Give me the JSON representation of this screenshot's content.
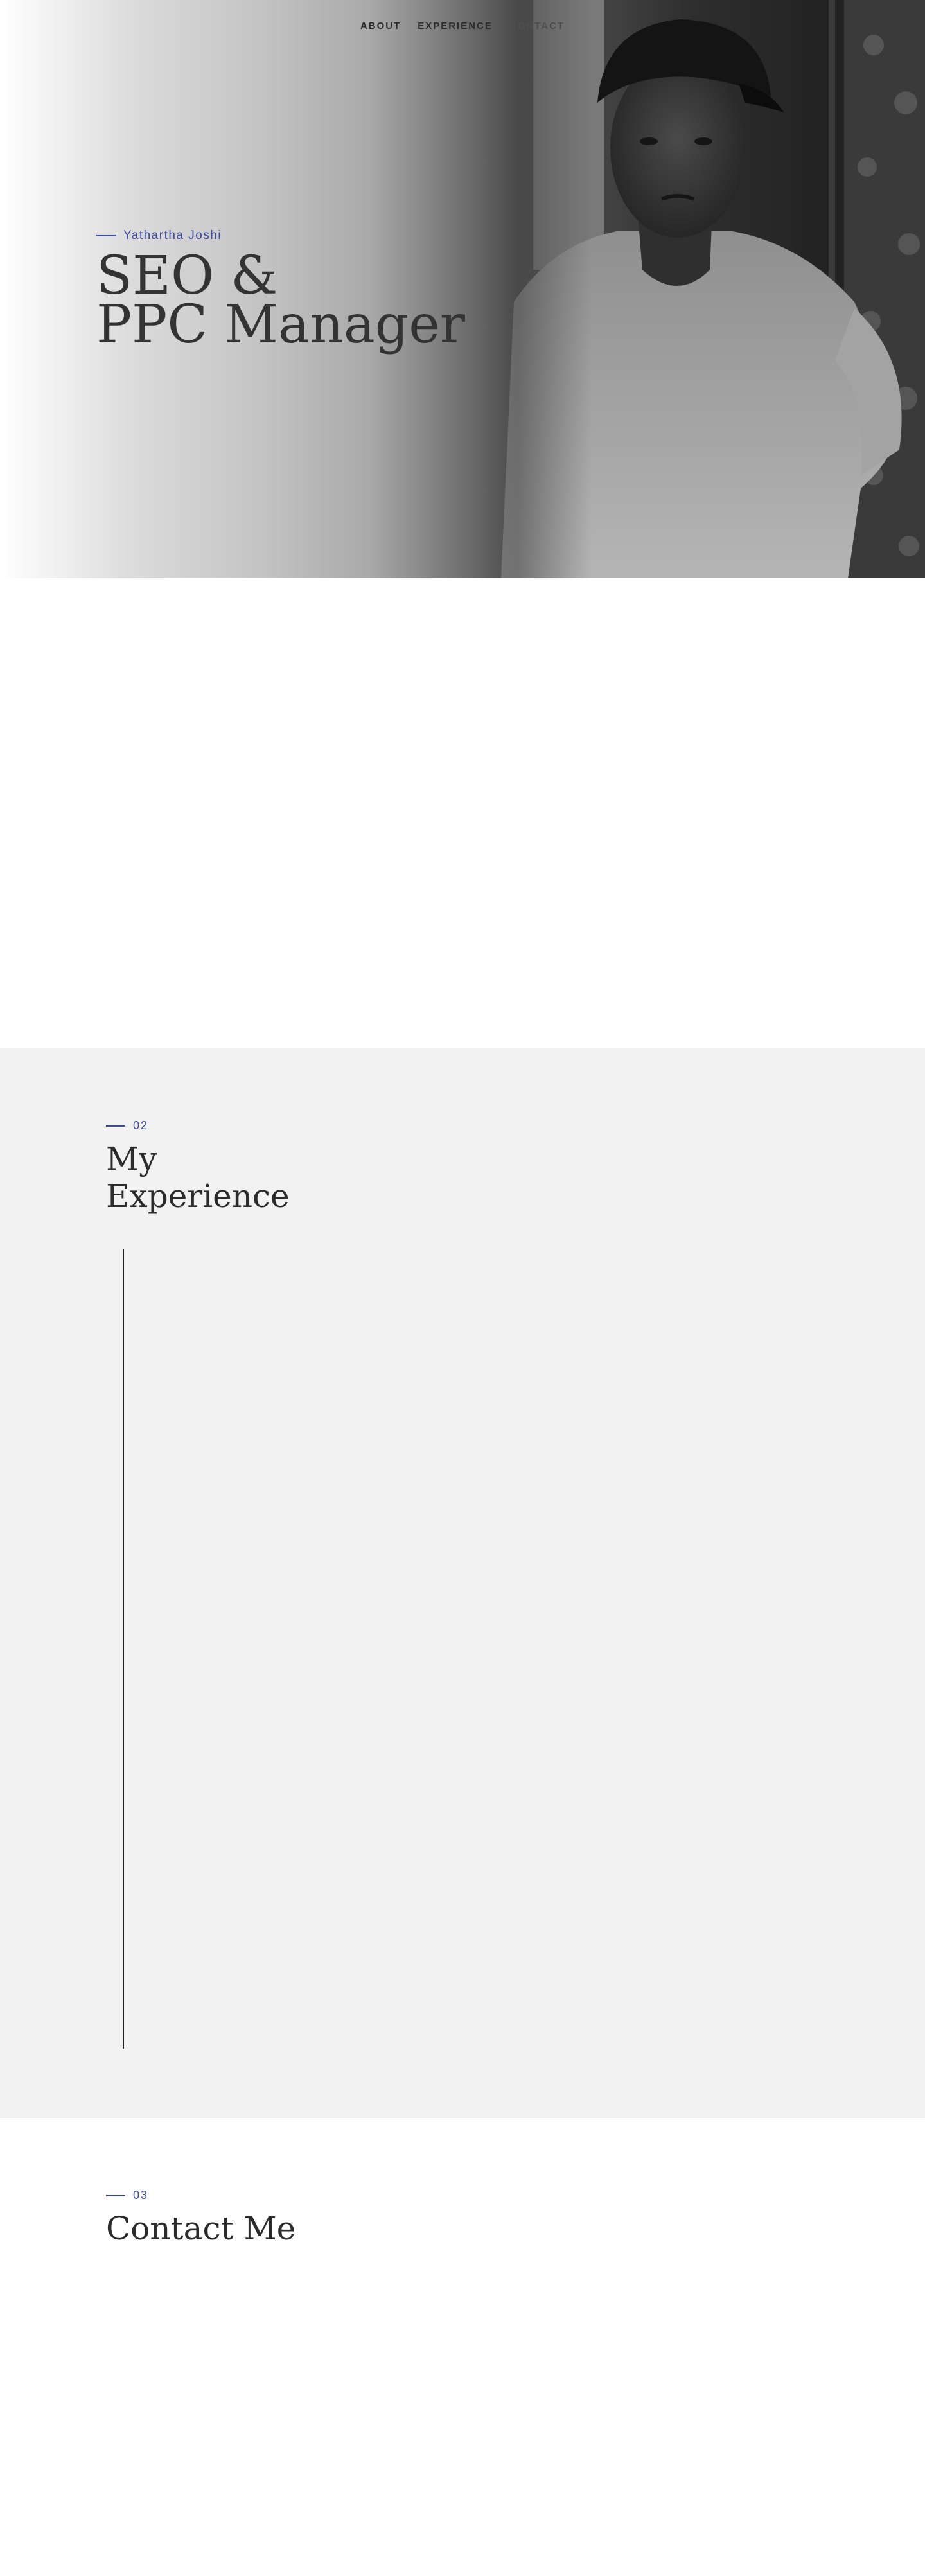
{
  "nav": {
    "items": [
      {
        "label": "ABOUT"
      },
      {
        "label": "EXPERIENCE"
      },
      {
        "label": "CONTACT"
      }
    ]
  },
  "hero": {
    "name": "Yathartha Joshi",
    "title_line1": "SEO &",
    "title_line2": "PPC Manager"
  },
  "experience": {
    "number": "02",
    "title_line1": "My",
    "title_line2": "Experience"
  },
  "contact": {
    "number": "03",
    "title": "Contact Me"
  },
  "colors": {
    "accent": "#3a4a9a",
    "text": "#2b2b2b",
    "section_bg": "#f2f2f2"
  }
}
